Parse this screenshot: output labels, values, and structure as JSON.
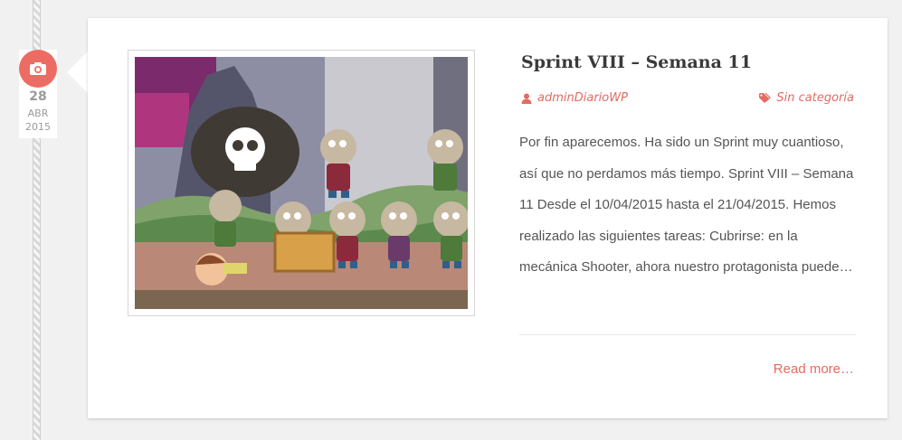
{
  "date": {
    "day": "28",
    "month": "ABR",
    "year": "2015",
    "icon": "camera-icon"
  },
  "post": {
    "title": "Sprint VIII – Semana 11",
    "author": "adminDiarioWP",
    "category": "Sin categoría",
    "excerpt": "Por fin aparecemos. Ha sido un Sprint muy cuantioso, así que no perdamos más tiempo. Sprint VIII – Semana 11 Desde el 10/04/2015 hasta el 21/04/2015. Hemos realizado las siguientes tareas: Cubrirse: en la mecánica Shooter, ahora nuestro protagonista puede…",
    "read_more": "Read more…"
  },
  "colors": {
    "accent": "#e26b63",
    "badge": "#ec6c63"
  }
}
